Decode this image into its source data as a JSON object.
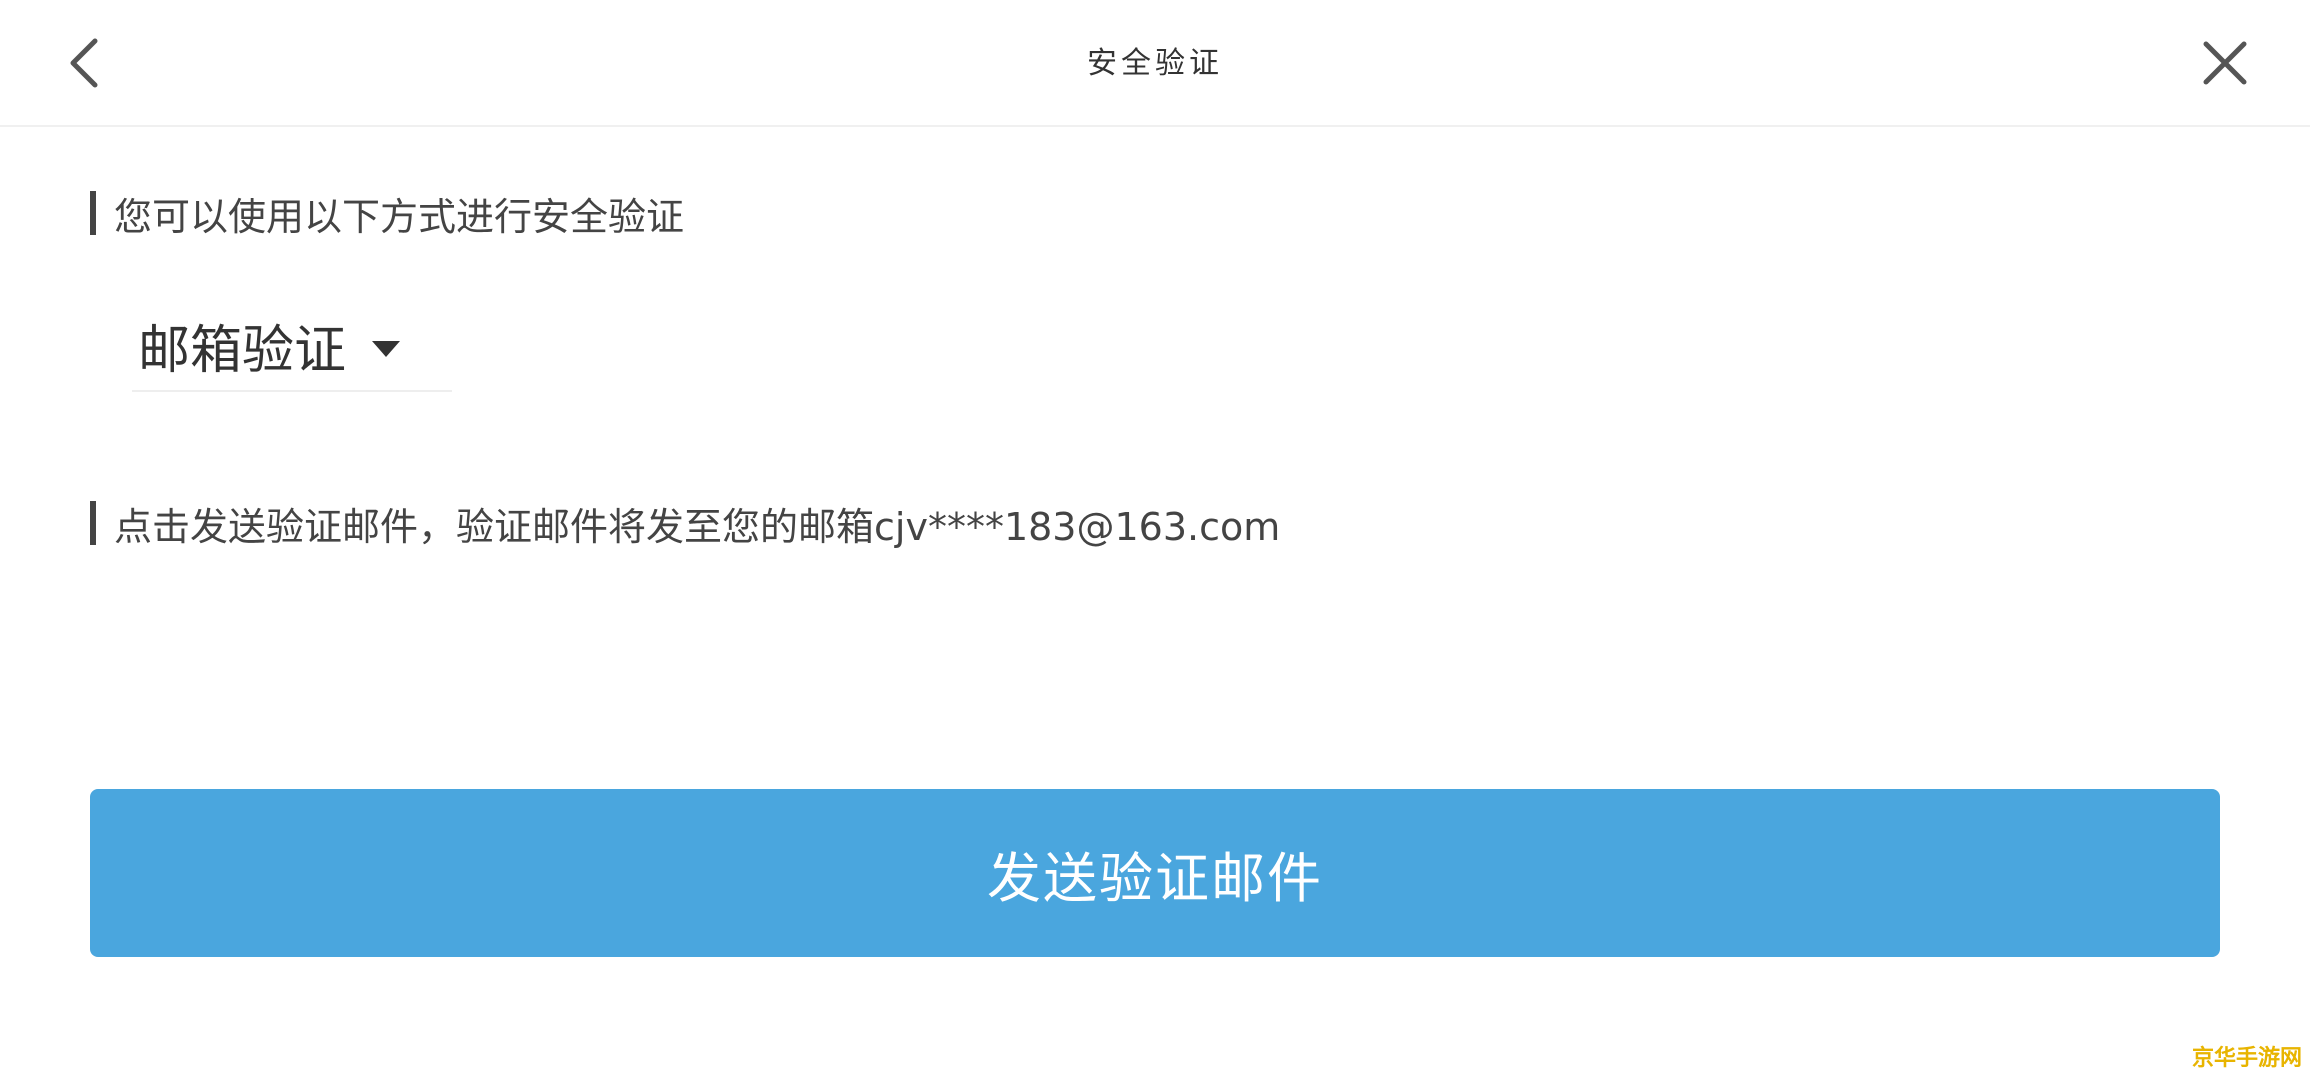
{
  "header": {
    "title": "安全验证",
    "back_icon": "chevron-left-icon",
    "close_icon": "close-icon"
  },
  "section_methods": {
    "label": "您可以使用以下方式进行安全验证"
  },
  "method_select": {
    "selected": "邮箱验证",
    "caret_icon": "caret-down-icon"
  },
  "section_email": {
    "label": "点击发送验证邮件，验证邮件将发至您的邮箱cjv****183@163.com"
  },
  "send_button": {
    "label": "发送验证邮件",
    "color": "#4aa6de"
  },
  "watermark": {
    "text": "京华手游网"
  }
}
